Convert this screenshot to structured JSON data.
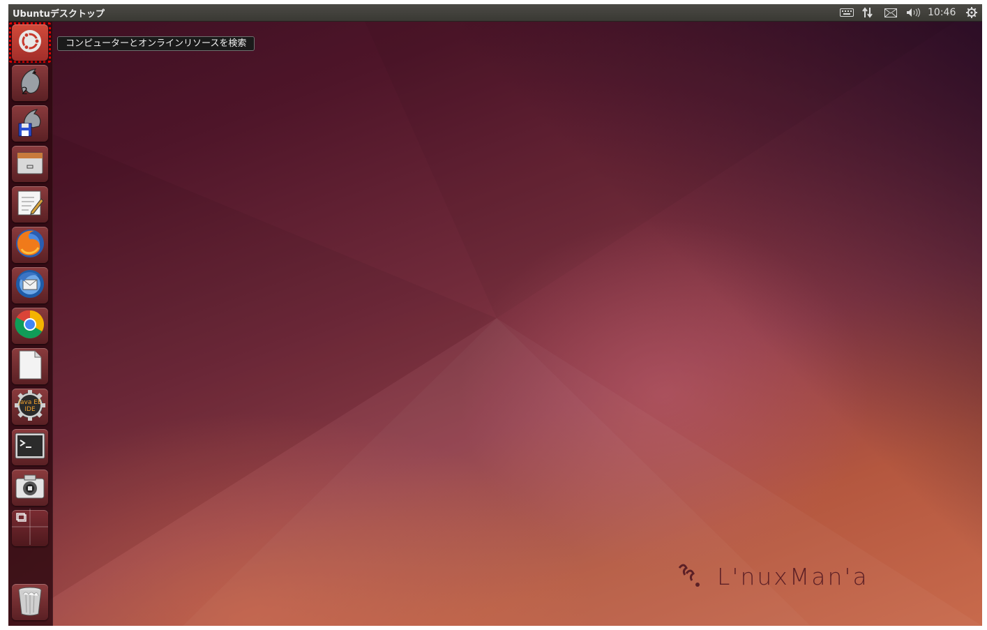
{
  "top_panel": {
    "title": "Ubuntuデスクトップ",
    "clock": "10:46",
    "indicators": [
      "keyboard-icon",
      "network-icon",
      "mail-icon",
      "volume-icon",
      "gear-icon"
    ]
  },
  "launcher": {
    "items": [
      {
        "name": "dash-home",
        "icon": "ubuntu-logo-icon"
      },
      {
        "name": "dolphin-2",
        "icon": "dolphin-icon"
      },
      {
        "name": "dolphin-save",
        "icon": "dolphin-floppy-icon"
      },
      {
        "name": "file-manager",
        "icon": "file-cabinet-icon"
      },
      {
        "name": "text-editor",
        "icon": "text-editor-icon"
      },
      {
        "name": "firefox",
        "icon": "firefox-icon"
      },
      {
        "name": "thunderbird",
        "icon": "thunderbird-icon"
      },
      {
        "name": "chrome",
        "icon": "chrome-icon"
      },
      {
        "name": "libreoffice",
        "icon": "document-icon"
      },
      {
        "name": "eclipse-java-ee",
        "icon": "java-ee-ide-icon",
        "label": "Java EE IDE"
      },
      {
        "name": "terminal",
        "icon": "terminal-icon"
      },
      {
        "name": "screenshot",
        "icon": "camera-icon"
      },
      {
        "name": "workspace-switcher",
        "icon": "workspace-switcher-icon"
      },
      {
        "name": "trash",
        "icon": "trash-icon"
      }
    ],
    "tooltip": "コンピューターとオンラインリソースを検索"
  },
  "watermark": {
    "text": "L'nuxMan'a",
    "icon": "linuxmania-logo-icon"
  },
  "colors": {
    "panel": "#3c3b37",
    "accent": "#e30000",
    "launcher": "#2d0810"
  }
}
